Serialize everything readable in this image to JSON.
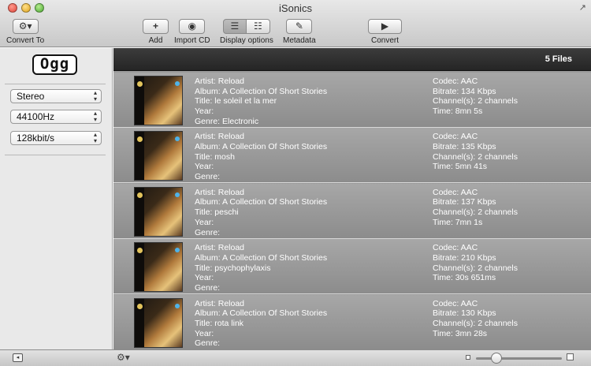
{
  "window": {
    "title": "iSonics"
  },
  "toolbar": {
    "convert_to_label": "Convert To",
    "add_label": "Add",
    "import_cd_label": "Import CD",
    "display_options_label": "Display options",
    "metadata_label": "Metadata",
    "convert_label": "Convert"
  },
  "sidebar": {
    "logo_text": "Ogg",
    "channels": "Stereo",
    "sample_rate": "44100Hz",
    "bitrate": "128kbit/s"
  },
  "list": {
    "file_count": "5 Files",
    "files": [
      {
        "artist": "Artist: Reload",
        "album": "Album: A Collection Of Short Stories",
        "title": "Title: le soleil et la mer",
        "year": "Year:",
        "genre": "Genre: Electronic",
        "codec": "Codec: AAC",
        "bitrate": "Bitrate: 134 Kbps",
        "channels": "Channel(s): 2 channels",
        "time": "Time: 8mn 5s"
      },
      {
        "artist": "Artist: Reload",
        "album": "Album: A Collection Of Short Stories",
        "title": "Title: mosh",
        "year": "Year:",
        "genre": "Genre:",
        "codec": "Codec: AAC",
        "bitrate": "Bitrate: 135 Kbps",
        "channels": "Channel(s): 2 channels",
        "time": "Time: 5mn 41s"
      },
      {
        "artist": "Artist: Reload",
        "album": "Album: A Collection Of Short Stories",
        "title": "Title: peschi",
        "year": "Year:",
        "genre": "Genre:",
        "codec": "Codec: AAC",
        "bitrate": "Bitrate: 137 Kbps",
        "channels": "Channel(s): 2 channels",
        "time": "Time: 7mn 1s"
      },
      {
        "artist": "Artist: Reload",
        "album": "Album: A Collection Of Short Stories",
        "title": "Title: psychophylaxis",
        "year": "Year:",
        "genre": "Genre:",
        "codec": "Codec: AAC",
        "bitrate": "Bitrate: 210 Kbps",
        "channels": "Channel(s): 2 channels",
        "time": "Time: 30s 651ms"
      },
      {
        "artist": "Artist: Reload",
        "album": "Album: A Collection Of Short Stories",
        "title": "Title: rota link",
        "year": "Year:",
        "genre": "Genre:",
        "codec": "Codec: AAC",
        "bitrate": "Bitrate: 130 Kbps",
        "channels": "Channel(s): 2 channels",
        "time": "Time: 3mn 28s"
      }
    ]
  },
  "statusbar": {
    "zoom_level": 0.2
  },
  "icons": {
    "convert_to": "gear-icon",
    "add": "plus-icon",
    "import_cd": "cd-icon",
    "display_options": "view-mode-icons",
    "metadata": "edit-icon",
    "convert": "play-icon"
  }
}
